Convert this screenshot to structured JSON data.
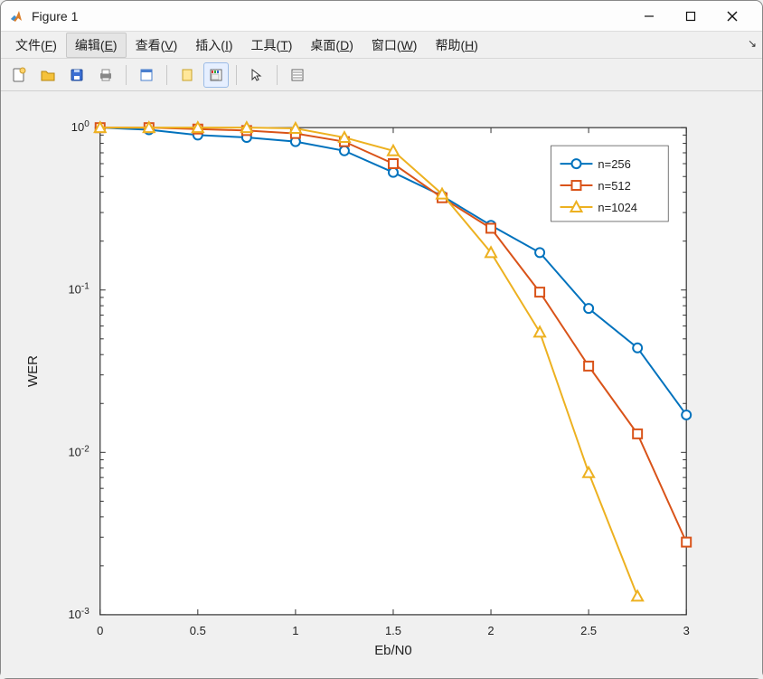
{
  "window": {
    "title": "Figure 1"
  },
  "menu": {
    "items": [
      {
        "label": "文件",
        "mn": "F"
      },
      {
        "label": "编辑",
        "mn": "E"
      },
      {
        "label": "查看",
        "mn": "V"
      },
      {
        "label": "插入",
        "mn": "I"
      },
      {
        "label": "工具",
        "mn": "T"
      },
      {
        "label": "桌面",
        "mn": "D"
      },
      {
        "label": "窗口",
        "mn": "W"
      },
      {
        "label": "帮助",
        "mn": "H"
      }
    ]
  },
  "toolbar": {
    "buttons": [
      "new-figure-icon",
      "open-icon",
      "save-icon",
      "print-icon",
      "sep",
      "edit-plot-icon",
      "sep",
      "link-icon",
      "colorbar-icon",
      "sep",
      "pointer-icon",
      "sep",
      "datatip-icon"
    ]
  },
  "chart_data": {
    "type": "line",
    "xlabel": "Eb/N0",
    "ylabel": "WER",
    "xlim": [
      0,
      3
    ],
    "ylim": [
      0.001,
      1
    ],
    "yscale": "log",
    "xticks": [
      0,
      0.5,
      1,
      1.5,
      2,
      2.5,
      3
    ],
    "yticks_exp": [
      0,
      -1,
      -2,
      -3
    ],
    "x": [
      0,
      0.25,
      0.5,
      0.75,
      1,
      1.25,
      1.5,
      1.75,
      2,
      2.25,
      2.5,
      2.75,
      3
    ],
    "series": [
      {
        "name": "n=256",
        "color": "#0072BD",
        "marker": "circle",
        "values": [
          1.0,
          0.97,
          0.9,
          0.87,
          0.82,
          0.72,
          0.53,
          0.38,
          0.25,
          0.17,
          0.077,
          0.044,
          0.017
        ]
      },
      {
        "name": "n=512",
        "color": "#D95319",
        "marker": "square",
        "values": [
          1.0,
          1.0,
          0.98,
          0.96,
          0.92,
          0.82,
          0.6,
          0.37,
          0.24,
          0.097,
          0.034,
          0.013,
          0.0028
        ]
      },
      {
        "name": "n=1024",
        "color": "#EDB120",
        "marker": "triangle",
        "values": [
          1.0,
          1.0,
          1.0,
          1.0,
          0.99,
          0.87,
          0.72,
          0.39,
          0.17,
          0.055,
          0.0075,
          0.0013
        ]
      }
    ],
    "legend": {
      "position": "northeast"
    }
  }
}
